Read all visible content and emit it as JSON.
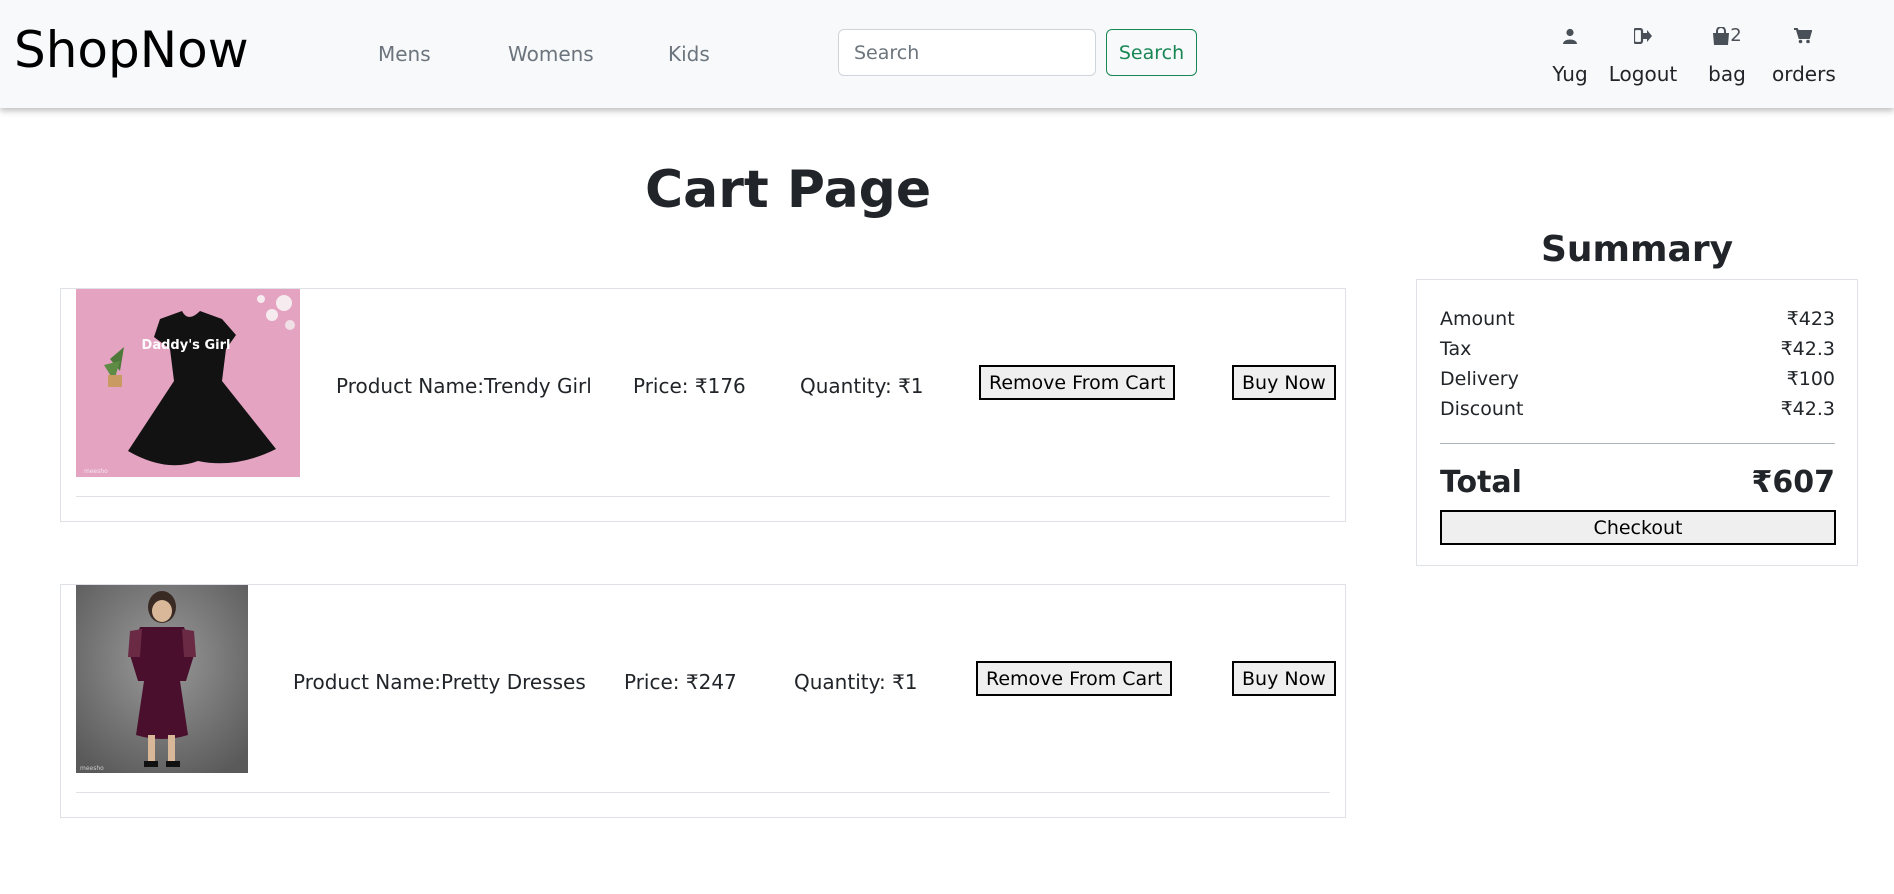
{
  "brand": "ShopNow",
  "nav": {
    "links": [
      "Mens",
      "Womens",
      "Kids"
    ],
    "search_placeholder": "Search",
    "search_button": "Search",
    "user": {
      "icon": "user-icon",
      "label": "Yug"
    },
    "logout": {
      "icon": "logout-icon",
      "label": "Logout"
    },
    "bag": {
      "icon": "shopping-bag-icon",
      "count": "2",
      "label": "bag"
    },
    "orders": {
      "icon": "cart-icon",
      "label": "orders"
    }
  },
  "page_title": "Cart Page",
  "cart_items": [
    {
      "name": "Product Name:Trendy Girl",
      "price": "Price: ₹176",
      "quantity": "Quantity: ₹1",
      "remove_label": "Remove From Cart",
      "buy_label": "Buy Now",
      "image_caption": "Daddy's Girl"
    },
    {
      "name": "Product Name:Pretty Dresses",
      "price": "Price: ₹247",
      "quantity": "Quantity: ₹1",
      "remove_label": "Remove From Cart",
      "buy_label": "Buy Now"
    }
  ],
  "summary": {
    "title": "Summary",
    "rows": [
      {
        "label": "Amount",
        "value": "₹423"
      },
      {
        "label": "Tax",
        "value": "₹42.3"
      },
      {
        "label": "Delivery",
        "value": "₹100"
      },
      {
        "label": "Discount",
        "value": "₹42.3"
      }
    ],
    "total_label": "Total",
    "total_value": "₹607",
    "checkout_label": "Checkout"
  },
  "colors": {
    "navbar_bg": "#f8f9fa",
    "search_button": "#198754",
    "nav_link": "#6c757d"
  }
}
